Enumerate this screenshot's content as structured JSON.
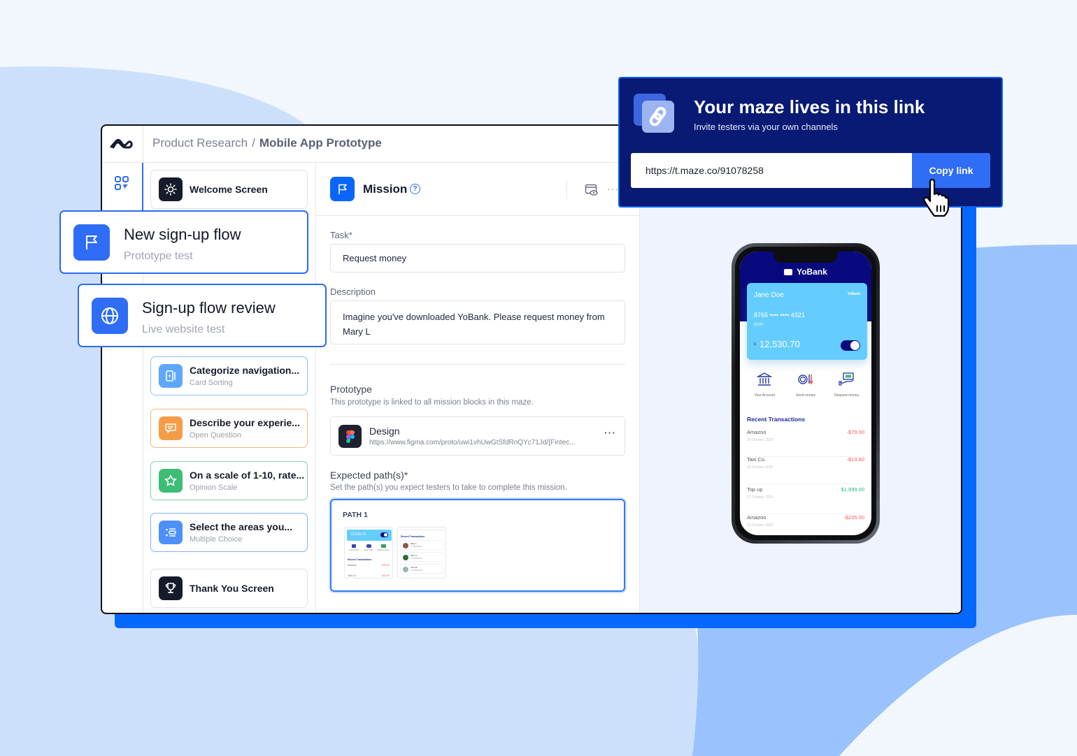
{
  "colors": {
    "background": "#f2f7fe",
    "accent": "#2f6df6",
    "shadow_slab": "#0568fd",
    "share_panel": "#081a73",
    "bank_header": "#08097f",
    "card": "#65cdfd",
    "negative": "#f05a5a",
    "positive": "#20b877"
  },
  "topbar": {
    "breadcrumb": [
      {
        "label": "Product Research"
      },
      {
        "label": "Mobile App Prototype"
      }
    ],
    "separator": "/"
  },
  "blocks": [
    {
      "title": "Welcome Screen",
      "subtitle": "",
      "icon": "sun-icon",
      "color": "#161b2c"
    },
    {
      "title": "Categorize navigation...",
      "subtitle": "Card Sorting",
      "icon": "card-sort-icon",
      "color": "#5fa7fb"
    },
    {
      "title": "Describe your experie...",
      "subtitle": "Open Question",
      "icon": "chat-icon",
      "color": "#f59c48"
    },
    {
      "title": "On a scale of 1-10, rate...",
      "subtitle": "Opinion Scale",
      "icon": "star-icon",
      "color": "#3ebd74"
    },
    {
      "title": "Select the areas you...",
      "subtitle": "Multiple Choice",
      "icon": "list-icon",
      "color": "#4d90fa"
    },
    {
      "title": "Thank You Screen",
      "subtitle": "",
      "icon": "trophy-icon",
      "color": "#161b2c"
    }
  ],
  "floating_cards": [
    {
      "title": "New sign-up flow",
      "subtitle": "Prototype test",
      "icon": "flag-icon"
    },
    {
      "title": "Sign-up flow review",
      "subtitle": "Live website test",
      "icon": "globe-icon"
    }
  ],
  "editor": {
    "title": "Mission",
    "help": "?",
    "more": "···",
    "task_label": "Task*",
    "task_value": "Request money",
    "description_label": "Description",
    "description_value": "Imagine you've downloaded YoBank. Please request money from Mary L",
    "prototype_label": "Prototype",
    "prototype_hint": "This prototype is linked to all mission blocks in this maze.",
    "prototype_name": "Design",
    "prototype_url": "https://www.figma.com/proto/uwi1vhUwGtSfdRnQYc71Jd/[Fintec...",
    "prototype_more": "···",
    "paths_label": "Expected path(s)*",
    "paths_hint": "Set the path(s) you expect testers to take to complete this mission.",
    "path_title": "PATH 1",
    "thumb1": {
      "balance": "12,530.70",
      "actions": [
        "Your Account",
        "Send money",
        "Request money"
      ],
      "section": "Recent Transactions",
      "rows": [
        {
          "name": "Amazoo",
          "amount": "-$79.00"
        },
        {
          "name": "Taxi Co.",
          "amount": "-$13.60"
        }
      ]
    },
    "thumb2": {
      "section": "Recent Transactions",
      "contacts": [
        {
          "name": "Mary L",
          "phone": "+13463489574"
        },
        {
          "name": "Paul G",
          "phone": "+13490388714"
        },
        {
          "name": "John B",
          "phone": "+13709956781"
        }
      ]
    }
  },
  "phone": {
    "bank": "YoBank",
    "card_holder": "Jane Doe",
    "card_brand": "YoBank",
    "card_number": "8765 •••• •••• 4321",
    "card_expiry": "01/27",
    "currency": "$",
    "balance": "12,530.70",
    "card_toggle_on": true,
    "actions": [
      {
        "label": "Your Account",
        "icon": "bank-icon"
      },
      {
        "label": "Send money",
        "icon": "send-money-icon"
      },
      {
        "label": "Request money",
        "icon": "request-money-icon"
      }
    ],
    "transactions_title": "Recent Transactions",
    "transactions": [
      {
        "name": "Amazoo",
        "date": "29 October 2020",
        "amount": "-$79.00",
        "type": "negative"
      },
      {
        "name": "Taxi Co.",
        "date": "22 October 2020",
        "amount": "-$13.60",
        "type": "negative"
      },
      {
        "name": "Top up",
        "date": "21 October 2020",
        "amount": "$1,999.00",
        "type": "positive"
      },
      {
        "name": "Amazoo",
        "date": "21 October 2020",
        "amount": "-$235.00",
        "type": "negative"
      }
    ]
  },
  "share": {
    "title": "Your maze lives in this link",
    "subtitle": "Invite testers via your own channels",
    "url": "https://t.maze.co/91078258",
    "copy_label": "Copy link"
  }
}
